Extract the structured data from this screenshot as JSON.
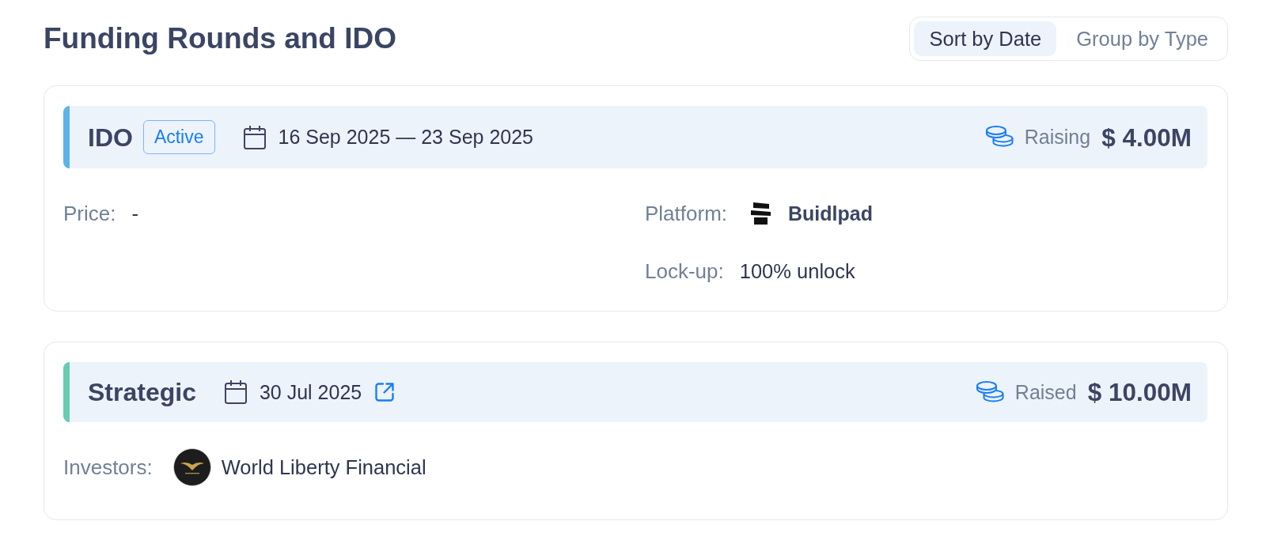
{
  "title": "Funding Rounds and IDO",
  "view_toggle": [
    {
      "label": "Sort by Date",
      "selected": true
    },
    {
      "label": "Group by Type",
      "selected": false
    }
  ],
  "rounds": [
    {
      "name": "IDO",
      "color": "#5ab4e8",
      "status": "Active",
      "date": "16 Sep 2025 — 23 Sep 2025",
      "external_link": false,
      "amount_label": "Raising",
      "amount": "$ 4.00M",
      "columns": [
        [
          {
            "kind": "text",
            "label": "Price:",
            "value": "-"
          }
        ],
        [
          {
            "kind": "platform",
            "label": "Platform:",
            "value": "Buidlpad"
          },
          {
            "kind": "text",
            "label": "Lock-up:",
            "value": "100% unlock"
          }
        ]
      ]
    },
    {
      "name": "Strategic",
      "color": "#66cdb0",
      "date": "30 Jul 2025",
      "external_link": true,
      "amount_label": "Raised",
      "amount": "$ 10.00M",
      "columns": [
        [
          {
            "kind": "investor",
            "label": "Investors:",
            "value": "World Liberty Financial"
          }
        ]
      ]
    }
  ]
}
